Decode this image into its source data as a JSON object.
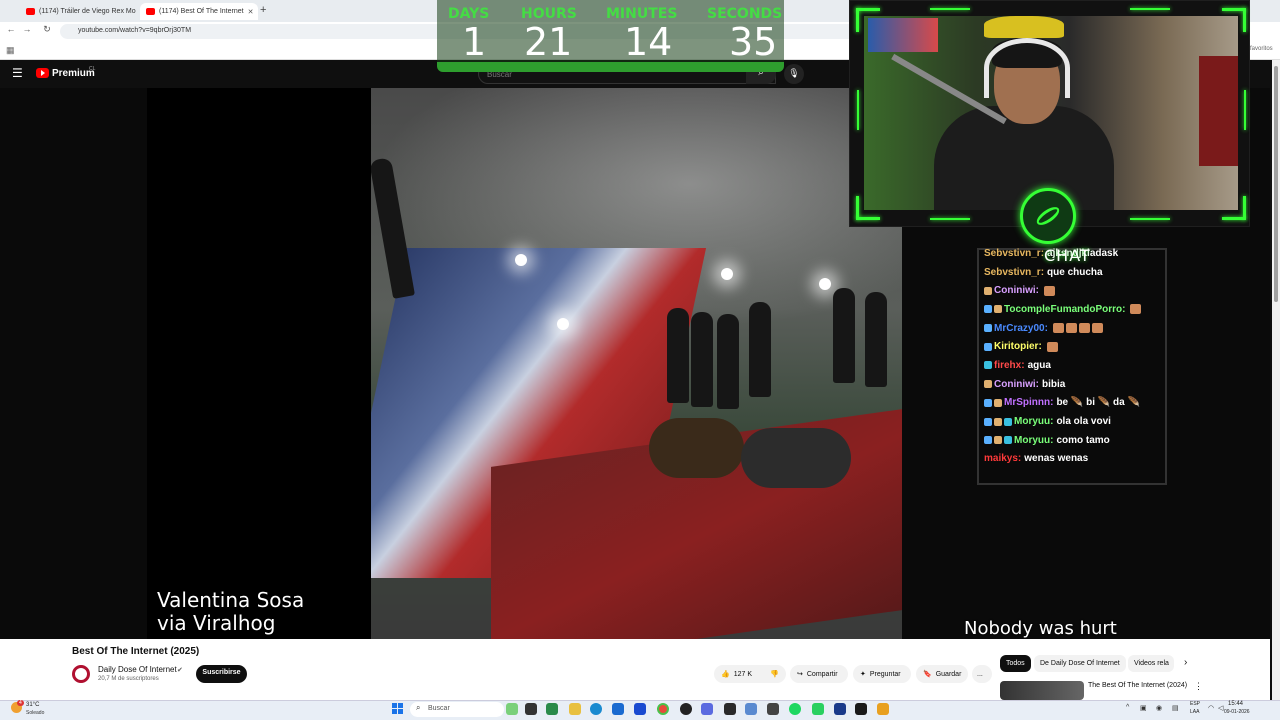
{
  "browser": {
    "tabs": [
      {
        "label": "(1174) Tráiler de Viego Rex Mo",
        "active": false
      },
      {
        "label": "(1174) Best Of The Internet",
        "active": true
      }
    ],
    "new_tab": "+",
    "close": "✕",
    "url": "youtube.com/watch?v=9qbrOrj30TM",
    "favorites_label": "favoritos"
  },
  "youtube": {
    "logo_text": "Premium",
    "region": "CL",
    "search_placeholder": "Buscar",
    "video": {
      "title": "Best Of The Internet (2025)",
      "caption_left": [
        "Valentina Sosa",
        "via Viralhog"
      ],
      "caption_right": "Nobody was hurt"
    },
    "channel": {
      "name": "Daily Dose Of Internet",
      "subscribers": "20,7 M de suscriptores",
      "subscribe_label": "Suscribirse"
    },
    "actions": {
      "likes": "127 K",
      "share": "Compartir",
      "ask": "Preguntar",
      "save": "Guardar",
      "more": "..."
    },
    "recommend_chips": [
      "Todos",
      "De Daily Dose Of Internet",
      "Videos rela"
    ],
    "recommendation": {
      "title": "The Best Of The Internet (2024)"
    }
  },
  "countdown": {
    "labels": [
      "DAYS",
      "HOURS",
      "MINUTES",
      "SECONDS"
    ],
    "values": [
      "1",
      "21",
      "14",
      "35"
    ]
  },
  "stream": {
    "chat_title": "CHAT",
    "chat_messages": [
      {
        "user": "Sebvstivn_r:",
        "text": "ajksndjkladask",
        "color": "#e8b860",
        "icons": []
      },
      {
        "user": "Sebvstivn_r:",
        "text": "que chucha",
        "color": "#e8b860",
        "icons": []
      },
      {
        "user": "Coniniwi:",
        "text": "",
        "color": "#d8a0ff",
        "icons": [
          "#e0b070"
        ],
        "emotes": 1
      },
      {
        "user": "TocompleFumandoPorro:",
        "text": "",
        "color": "#7aff7a",
        "icons": [
          "#5ab0ff",
          "#e0b070"
        ],
        "emotes": 1
      },
      {
        "user": "MrCrazy00:",
        "text": "",
        "color": "#4a8aff",
        "icons": [
          "#5ab0ff"
        ],
        "emotes": 4
      },
      {
        "user": "Kiritopier:",
        "text": "",
        "color": "#ffff6a",
        "icons": [
          "#5ab0ff"
        ],
        "emotes": 1
      },
      {
        "user": "firehx:",
        "text": "agua",
        "color": "#ff4a4a",
        "icons": [
          "#3ac0e0"
        ]
      },
      {
        "user": "Coniniwi:",
        "text": "bibia",
        "color": "#d8a0ff",
        "icons": [
          "#e0b070"
        ]
      },
      {
        "user": "MrSpinnn:",
        "text": "be 🪶 bi 🪶 da 🪶",
        "color": "#c070ff",
        "icons": [
          "#5ab0ff",
          "#e0b070"
        ]
      },
      {
        "user": "Moryuu:",
        "text": "ola ola vovi",
        "color": "#7aff7a",
        "icons": [
          "#5ab0ff",
          "#e0b070",
          "#3ac0e0"
        ]
      },
      {
        "user": "Moryuu:",
        "text": "como tamo",
        "color": "#7aff7a",
        "icons": [
          "#5ab0ff",
          "#e0b070",
          "#3ac0e0"
        ]
      },
      {
        "user": "maikys:",
        "text": "wenas wenas",
        "color": "#ff3a3a",
        "icons": []
      }
    ],
    "accent": "#35ff35"
  },
  "taskbar": {
    "weather": {
      "temp": "31°C",
      "condition": "Soleado",
      "badge": "4"
    },
    "search_placeholder": "Buscar",
    "lang": [
      "ESP",
      "LAA"
    ],
    "time": "15:44",
    "date": "09-01-2026"
  }
}
